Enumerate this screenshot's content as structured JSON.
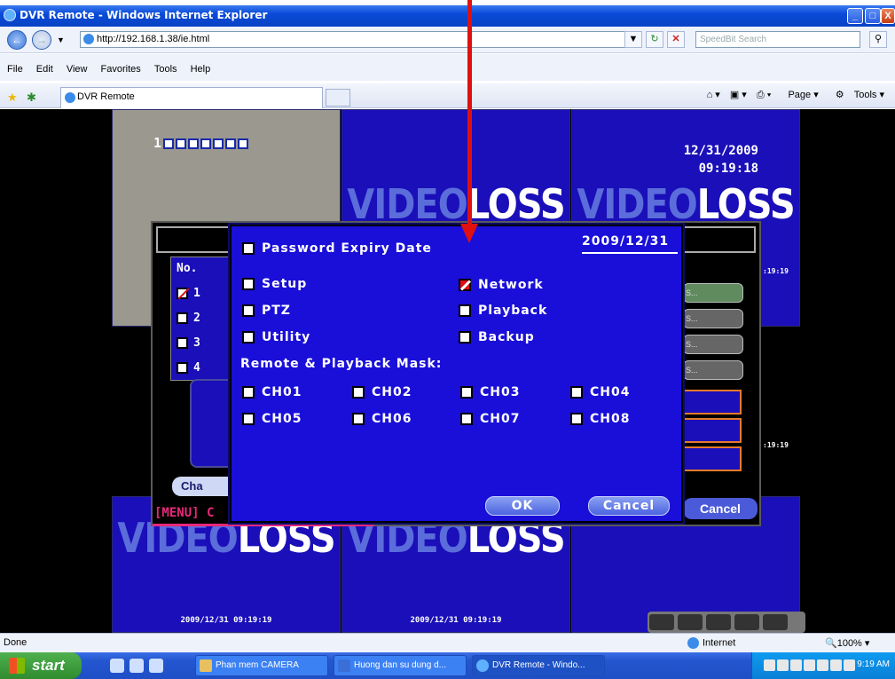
{
  "window": {
    "title": "DVR Remote - Windows Internet Explorer",
    "min": "_",
    "max": "□",
    "close": "X"
  },
  "address": {
    "url": "http://192.168.1.38/ie.html",
    "search_placeholder": "SpeedBit Search"
  },
  "menu": [
    "File",
    "Edit",
    "View",
    "Favorites",
    "Tools",
    "Help"
  ],
  "tab": {
    "label": "DVR Remote"
  },
  "toolbar_right": {
    "page": "Page",
    "tools": "Tools"
  },
  "dvr": {
    "ch_digit": "1",
    "datetime_date": "12/31/2009",
    "datetime_time": "09:19:18",
    "video_loss_a": "VIDEO",
    "video_loss_b": "LOSS",
    "cam_timestamp": "2009/12/31 09:19:19",
    "side_time": ":19:19",
    "side_time2": ":19:19",
    "user_header_no": "No.",
    "users": [
      "1",
      "2",
      "3",
      "4"
    ],
    "user_selected": "1",
    "change_button": "Cha",
    "menu_hint": "[MENU] C",
    "bg_cancel": "Cancel",
    "pill_text": "S..."
  },
  "dialog": {
    "password_expiry_label": "Password Expiry Date",
    "password_expiry_value": "2009/12/31",
    "permissions": [
      {
        "label": "Setup",
        "checked": false
      },
      {
        "label": "Network",
        "checked": true
      },
      {
        "label": "PTZ",
        "checked": false
      },
      {
        "label": "Playback",
        "checked": false
      },
      {
        "label": "Utility",
        "checked": false
      },
      {
        "label": "Backup",
        "checked": false
      }
    ],
    "mask_title": "Remote & Playback Mask:",
    "channels": [
      "CH01",
      "CH02",
      "CH03",
      "CH04",
      "CH05",
      "CH06",
      "CH07",
      "CH08"
    ],
    "ok": "OK",
    "cancel": "Cancel"
  },
  "status": {
    "done": "Done",
    "zone": "Internet",
    "zoom": "100%"
  },
  "taskbar": {
    "start": "start",
    "tasks": [
      "Phan mem CAMERA",
      "Huong dan su dung d...",
      "DVR Remote - Windo..."
    ],
    "clock": "9:19 AM"
  },
  "colors": {
    "dvr_blue": "#1a0fd8",
    "check_red": "#e01010",
    "arrow_red": "#e01010",
    "menu_pink": "#e8287a"
  }
}
